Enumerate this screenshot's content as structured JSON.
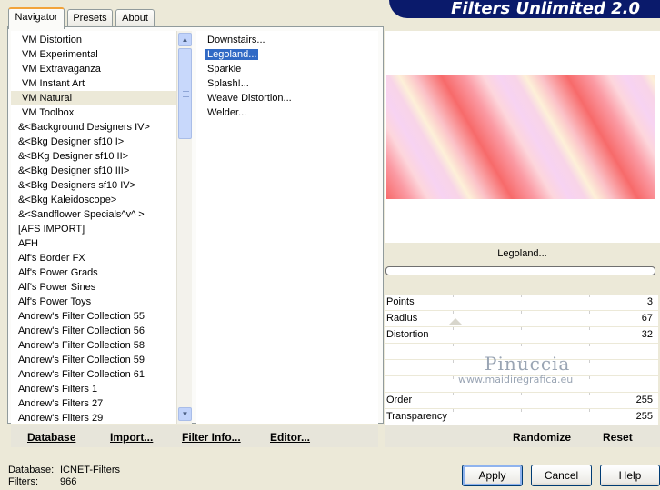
{
  "app_title": "Filters Unlimited 2.0",
  "tabs": [
    "Navigator",
    "Presets",
    "About"
  ],
  "categories": [
    "VM Distortion",
    "VM Experimental",
    "VM Extravaganza",
    "VM Instant Art",
    "VM Natural",
    "VM Toolbox",
    "&<Background Designers IV>",
    "&<Bkg Designer sf10 I>",
    "&<BKg Designer sf10 II>",
    "&<Bkg Designer sf10 III>",
    "&<Bkg Designers sf10 IV>",
    "&<Bkg Kaleidoscope>",
    "&<Sandflower Specials^v^ >",
    "[AFS IMPORT]",
    "AFH",
    "Alf's Border FX",
    "Alf's Power Grads",
    "Alf's Power Sines",
    "Alf's Power Toys",
    "Andrew's Filter Collection 55",
    "Andrew's Filter Collection 56",
    "Andrew's Filter Collection 58",
    "Andrew's Filter Collection 59",
    "Andrew's Filter Collection 61",
    "Andrew's Filters 1",
    "Andrew's Filters 27",
    "Andrew's Filters 29"
  ],
  "selected_category": "VM Natural",
  "filters": [
    "Downstairs...",
    "Legoland...",
    "Sparkle",
    "Splash!...",
    "Weave Distortion...",
    "Welder..."
  ],
  "selected_filter": "Legoland...",
  "left_buttons": {
    "database": "Database",
    "import": "Import...",
    "filter_info": "Filter Info...",
    "editor": "Editor..."
  },
  "preview": {
    "filter_name": "Legoland...",
    "progress": 0
  },
  "params": [
    {
      "label": "Points",
      "value": "3"
    },
    {
      "label": "Radius",
      "value": "67"
    },
    {
      "label": "Distortion",
      "value": "32"
    },
    {
      "label": "",
      "value": ""
    },
    {
      "label": "",
      "value": ""
    },
    {
      "label": "",
      "value": ""
    },
    {
      "label": "Order",
      "value": "255"
    },
    {
      "label": "Transparency",
      "value": "255"
    }
  ],
  "watermark": {
    "name": "Pinuccia",
    "site": "www.maidiregrafica.eu"
  },
  "right_buttons": {
    "randomize": "Randomize",
    "reset": "Reset"
  },
  "footer": {
    "database_label": "Database:",
    "database_value": "ICNET-Filters",
    "filters_label": "Filters:",
    "filters_value": "966"
  },
  "dialog_buttons": {
    "apply": "Apply",
    "cancel": "Cancel",
    "help": "Help"
  }
}
